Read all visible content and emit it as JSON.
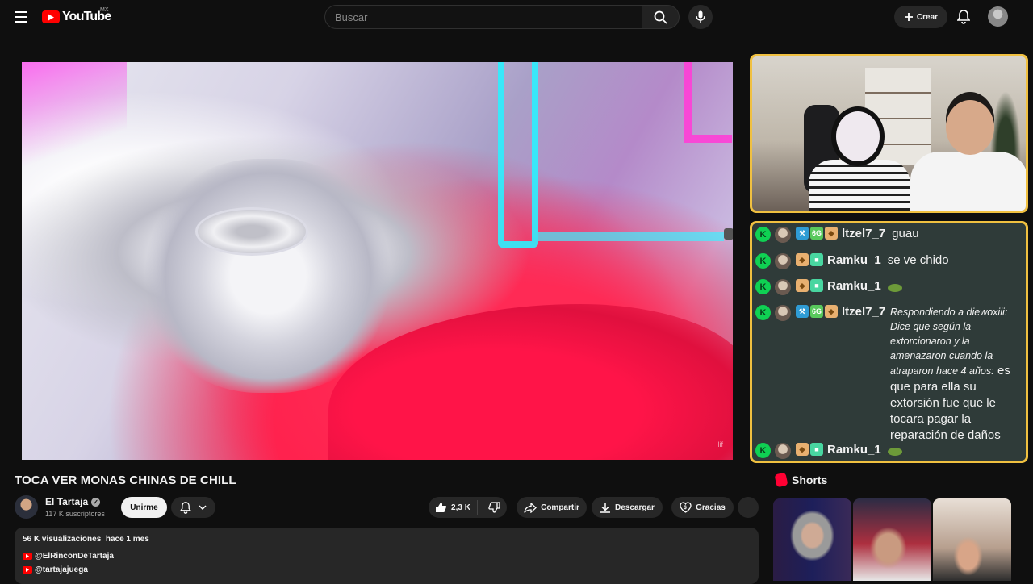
{
  "header": {
    "logo_text": "YouTube",
    "region": "MX",
    "search_placeholder": "Buscar",
    "create_label": "Crear"
  },
  "video": {
    "title": "TOCA VER MONAS CHINAS DE CHILL",
    "watermark": "ilif"
  },
  "channel": {
    "name": "El Tartaja",
    "subscribers": "117 K suscriptores",
    "join_label": "Unirme"
  },
  "actions": {
    "likes": "2,3 K",
    "share_label": "Compartir",
    "download_label": "Descargar",
    "thanks_label": "Gracias"
  },
  "description": {
    "views": "56 K visualizaciones",
    "age": "hace 1 mes",
    "links": [
      "@ElRinconDeTartaja",
      "@tartajajuega"
    ]
  },
  "stream_chat": {
    "messages": [
      {
        "user": "ltzel7_7",
        "text": "guau"
      },
      {
        "user": "Ramku_1",
        "text": "se ve chido"
      },
      {
        "user": "Ramku_1",
        "text": ""
      },
      {
        "user": "ltzel7_7",
        "reply": "Respondiendo a diewoxiii: Dice que según la extorcionaron y la amenazaron cuando la atraparon hace 4 años:",
        "text": "es que para ella su extorsión fue que le tocara pagar la reparación de daños"
      },
      {
        "user": "Ramku_1",
        "text": ""
      }
    ],
    "badge_text": "6G"
  },
  "shorts": {
    "heading": "Shorts"
  },
  "colors": {
    "brand_red": "#ff0000",
    "frame_yellow": "#f0c040",
    "chat_bg": "#2f3b39",
    "kick_green": "#0fd153"
  }
}
